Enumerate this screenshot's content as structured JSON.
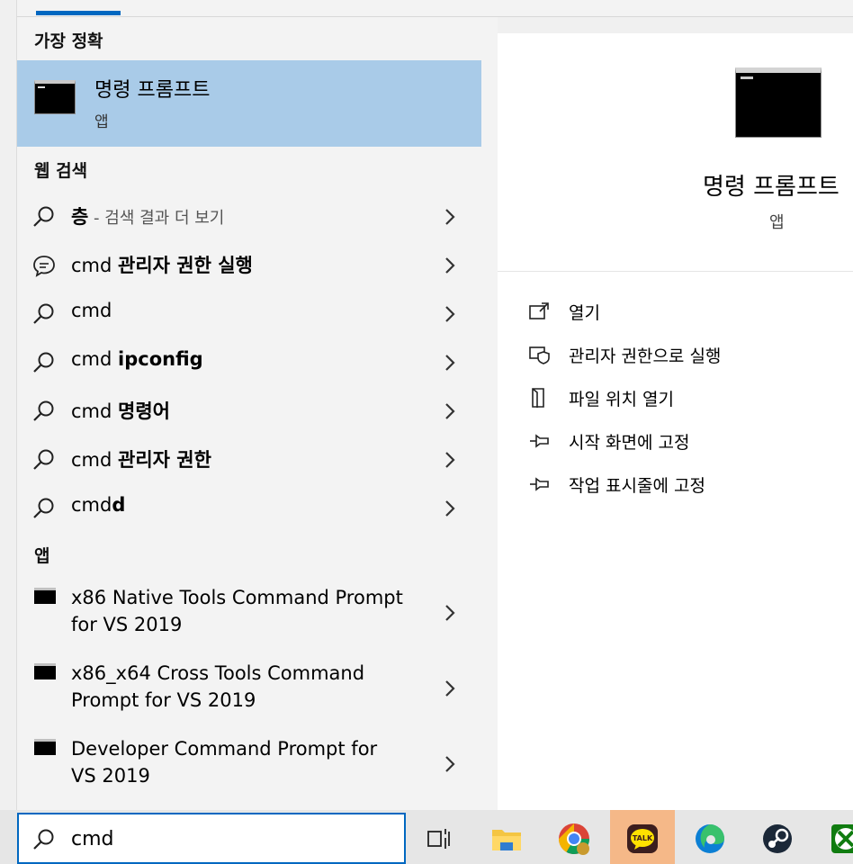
{
  "left_pane": {
    "best_match_title": "가장 정확",
    "best_match": {
      "name": "명령 프롬프트",
      "type": "앱"
    },
    "web_title": "웹 검색",
    "web_results": [
      {
        "prefix": "",
        "bold": "층",
        "suffix": " - 검색 결과 더 보기",
        "icon": "search-icon"
      },
      {
        "prefix": "cmd ",
        "bold": "관리자 권한 실행",
        "suffix": "",
        "icon": "chat-bubble-icon"
      },
      {
        "prefix": "cmd",
        "bold": "",
        "suffix": "",
        "icon": "search-icon"
      },
      {
        "prefix": "cmd ",
        "bold": "ipconfig",
        "suffix": "",
        "icon": "search-icon"
      },
      {
        "prefix": "cmd ",
        "bold": "명령어",
        "suffix": "",
        "icon": "search-icon"
      },
      {
        "prefix": "cmd ",
        "bold": "관리자 권한",
        "suffix": "",
        "icon": "search-icon"
      },
      {
        "prefix": "cmd",
        "bold": "d",
        "suffix": "",
        "icon": "search-icon"
      }
    ],
    "apps_title": "앱",
    "apps": [
      {
        "line1": "x86 Native Tools Command Prompt",
        "line2": "for VS 2019"
      },
      {
        "line1": "x86_x64 Cross Tools Command",
        "line2": "Prompt for VS 2019"
      },
      {
        "line1": "Developer Command Prompt for",
        "line2": "VS 2019"
      }
    ]
  },
  "detail_pane": {
    "title": "명령 프롬프트",
    "subtitle": "앱",
    "actions": [
      {
        "label": "열기",
        "icon": "open-icon"
      },
      {
        "label": "관리자 권한으로 실행",
        "icon": "shield-icon"
      },
      {
        "label": "파일 위치 열기",
        "icon": "file-location-icon"
      },
      {
        "label": "시작 화면에 고정",
        "icon": "pin-icon"
      },
      {
        "label": "작업 표시줄에 고정",
        "icon": "pin-icon"
      }
    ]
  },
  "taskbar": {
    "search_value": "cmd",
    "buttons": [
      {
        "name": "task-view",
        "icon": "task-view-icon"
      },
      {
        "name": "file-explorer",
        "icon": "folder-icon"
      },
      {
        "name": "chrome",
        "icon": "chrome-icon"
      },
      {
        "name": "kakaotalk",
        "icon": "kakaotalk-icon",
        "active": true,
        "badge": "TALK"
      },
      {
        "name": "edge",
        "icon": "edge-icon"
      },
      {
        "name": "steam",
        "icon": "steam-icon"
      },
      {
        "name": "xbox",
        "icon": "xbox-icon"
      }
    ]
  },
  "colors": {
    "accent": "#0067c0",
    "selection": "#a9cbe8",
    "active_taskbar": "#f5b888"
  }
}
